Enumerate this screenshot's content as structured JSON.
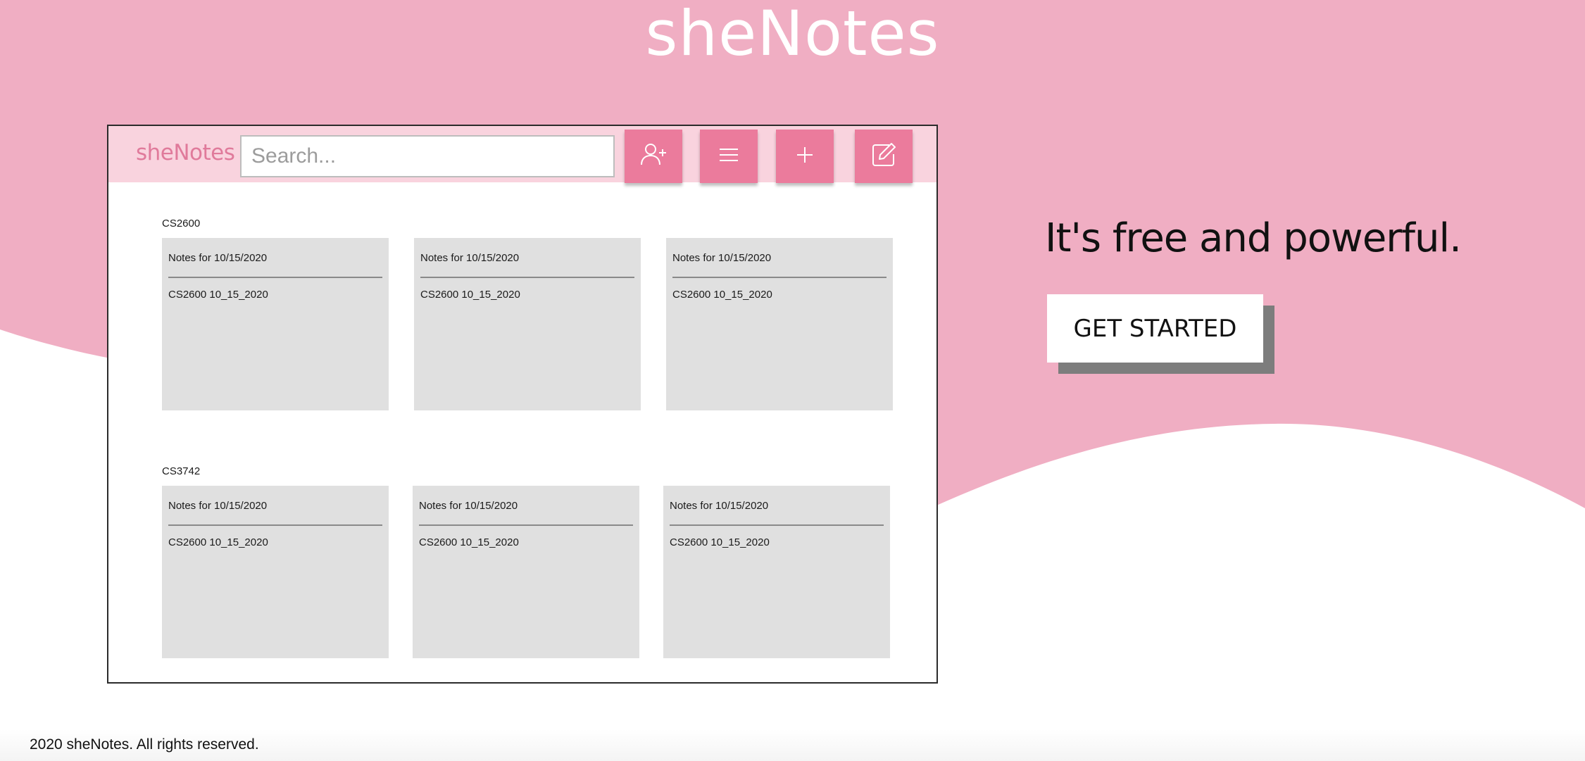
{
  "site": {
    "title": "sheNotes"
  },
  "mock_app": {
    "brand": "sheNotes",
    "search_placeholder": "Search...",
    "icons": [
      "add-user-icon",
      "menu-icon",
      "plus-icon",
      "edit-icon"
    ],
    "sections": [
      {
        "label": "CS2600",
        "notes": [
          {
            "title": "Notes for 10/15/2020",
            "body": "CS2600 10_15_2020"
          },
          {
            "title": "Notes for 10/15/2020",
            "body": "CS2600 10_15_2020"
          },
          {
            "title": "Notes for 10/15/2020",
            "body": "CS2600 10_15_2020"
          }
        ]
      },
      {
        "label": "CS3742",
        "notes": [
          {
            "title": "Notes for 10/15/2020",
            "body": "CS2600 10_15_2020"
          },
          {
            "title": "Notes for 10/15/2020",
            "body": "CS2600 10_15_2020"
          },
          {
            "title": "Notes for 10/15/2020",
            "body": "CS2600 10_15_2020"
          }
        ]
      }
    ]
  },
  "hero": {
    "tagline": "It's free and powerful.",
    "cta_label": "GET STARTED"
  },
  "footer": {
    "text": "2020 sheNotes. All rights reserved."
  },
  "colors": {
    "hero_pink": "#f0aec3",
    "navbar_pink": "#f9d3de",
    "button_pink": "#eb7b9c",
    "brand_pink": "#e07a9b",
    "card_gray": "#e0e0e0"
  }
}
